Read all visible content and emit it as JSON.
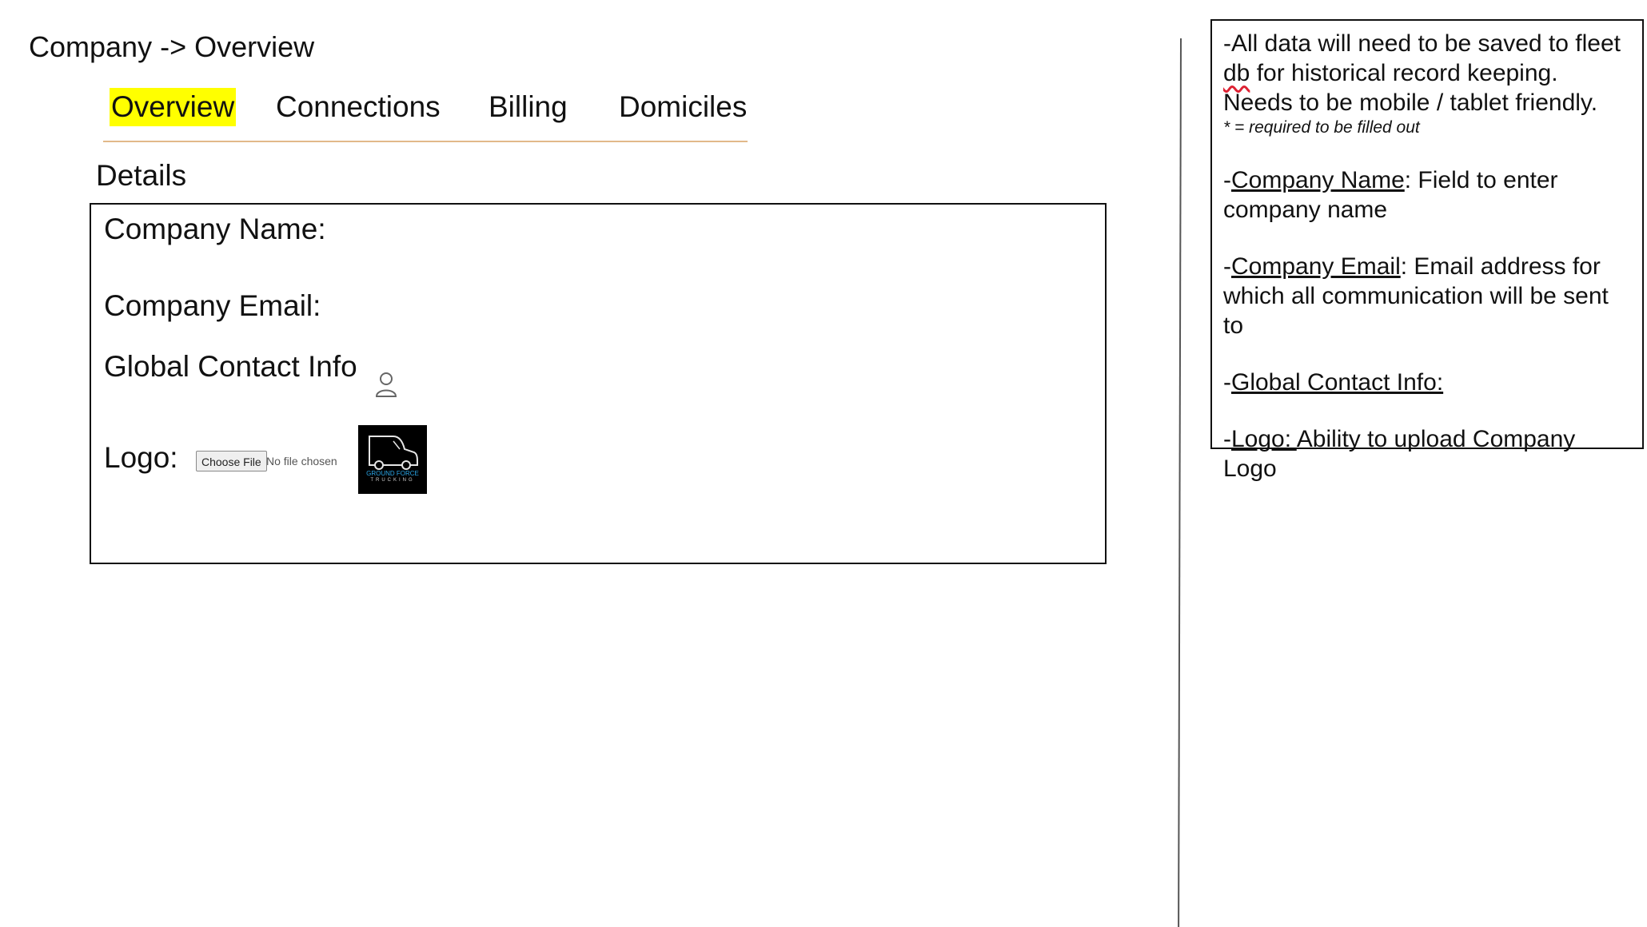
{
  "breadcrumb": {
    "text": "Company -> Overview"
  },
  "tabs": [
    {
      "label": "Overview",
      "active": true
    },
    {
      "label": "Connections",
      "active": false
    },
    {
      "label": "Billing",
      "active": false
    },
    {
      "label": "Domiciles",
      "active": false
    }
  ],
  "details": {
    "title": "Details",
    "company_name_label": "Company Name:",
    "company_email_label": "Company Email:",
    "global_contact_label": "Global Contact Info",
    "contact_icon": "person-icon",
    "logo_label": "Logo:",
    "file_button_label": "Choose File",
    "file_status": "No file chosen",
    "logo_image": {
      "line1": "GROUND FORCE",
      "line2": "TRUCKING"
    }
  },
  "notes": {
    "intro_prefix": "-All data will need to be saved to fleet",
    "intro_db": "db",
    "intro_suffix": " for historical record keeping. Needs to be mobile / tablet friendly.",
    "required_note": "* = required to be filled out",
    "company_name_term": "Company Name",
    "company_name_desc": ":  Field to enter company name",
    "company_email_term": "Company Email",
    "company_email_desc": ": Email address for which all communication will be sent to",
    "global_contact_term": "Global Contact Info:",
    "logo_term": "Logo:  ",
    "logo_desc": " Ability to upload Company Logo"
  },
  "colors": {
    "active_tab_highlight": "#ffff00",
    "tab_underline": "#e2b98a"
  }
}
